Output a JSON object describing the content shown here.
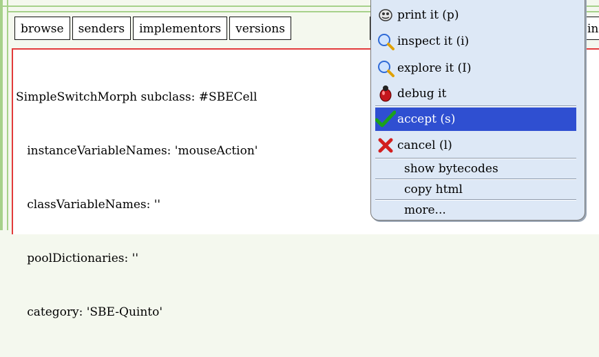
{
  "toolbar": {
    "buttons": [
      "browse",
      "senders",
      "implementors",
      "versions"
    ],
    "cut_label": "in"
  },
  "code": {
    "lines": [
      "SimpleSwitchMorph subclass: #SBECell",
      "   instanceVariableNames: 'mouseAction'",
      "   classVariableNames: ''",
      "   poolDictionaries: ''",
      "   category: 'SBE-Quinto'"
    ]
  },
  "menu": {
    "items": [
      {
        "label": "print it (p)",
        "icon": "print-icon"
      },
      {
        "label": "inspect it (i)",
        "icon": "magnifier-icon"
      },
      {
        "label": "explore it (I)",
        "icon": "magnifier-icon"
      },
      {
        "label": "debug it",
        "icon": "bug-icon"
      },
      {
        "label": "accept (s)",
        "icon": "checkmark-icon",
        "selected": true
      },
      {
        "label": "cancel (l)",
        "icon": "cross-icon"
      },
      {
        "label": "show bytecodes"
      },
      {
        "label": "copy html"
      },
      {
        "label": "more..."
      }
    ]
  },
  "colors": {
    "selection": "#2f4fd1",
    "menu_bg": "#dde8f6",
    "pane_border": "#e23a3a",
    "frame_green": "#a6d18a"
  }
}
